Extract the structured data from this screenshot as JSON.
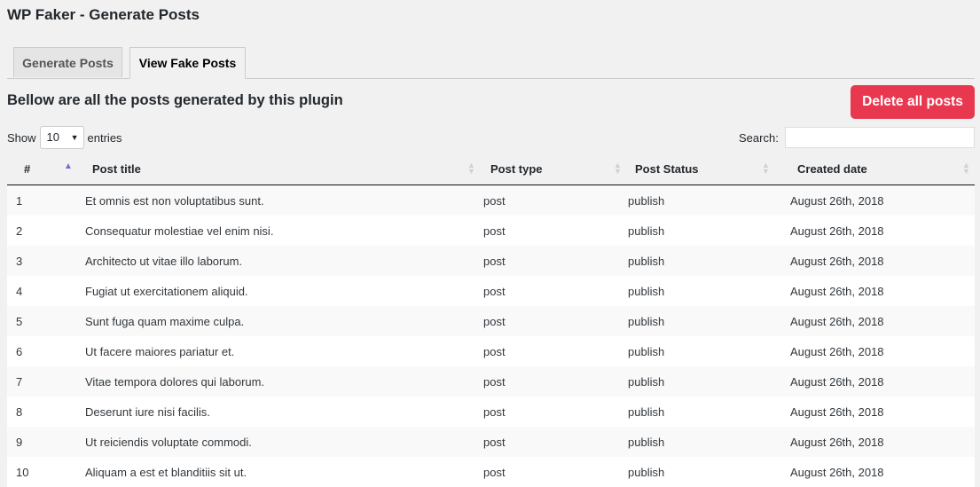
{
  "page": {
    "title": "WP Faker - Generate Posts"
  },
  "tabs": [
    {
      "label": "Generate Posts",
      "active": false
    },
    {
      "label": "View Fake Posts",
      "active": true
    }
  ],
  "section": {
    "heading": "Bellow are all the posts generated by this plugin",
    "delete_label": "Delete all posts",
    "delete_color": "#e8384f"
  },
  "controls": {
    "show_label": "Show",
    "page_length": "10",
    "entries_label": "entries",
    "search_label": "Search:",
    "search_value": ""
  },
  "table": {
    "columns": [
      "#",
      "Post title",
      "Post type",
      "Post Status",
      "Created date"
    ],
    "sorted_column": "#",
    "sort_direction": "asc",
    "rows": [
      {
        "num": "1",
        "title": "Et omnis est non voluptatibus sunt.",
        "type": "post",
        "status": "publish",
        "date": "August 26th, 2018"
      },
      {
        "num": "2",
        "title": "Consequatur molestiae vel enim nisi.",
        "type": "post",
        "status": "publish",
        "date": "August 26th, 2018"
      },
      {
        "num": "3",
        "title": "Architecto ut vitae illo laborum.",
        "type": "post",
        "status": "publish",
        "date": "August 26th, 2018"
      },
      {
        "num": "4",
        "title": "Fugiat ut exercitationem aliquid.",
        "type": "post",
        "status": "publish",
        "date": "August 26th, 2018"
      },
      {
        "num": "5",
        "title": "Sunt fuga quam maxime culpa.",
        "type": "post",
        "status": "publish",
        "date": "August 26th, 2018"
      },
      {
        "num": "6",
        "title": "Ut facere maiores pariatur et.",
        "type": "post",
        "status": "publish",
        "date": "August 26th, 2018"
      },
      {
        "num": "7",
        "title": "Vitae tempora dolores qui laborum.",
        "type": "post",
        "status": "publish",
        "date": "August 26th, 2018"
      },
      {
        "num": "8",
        "title": "Deserunt iure nisi facilis.",
        "type": "post",
        "status": "publish",
        "date": "August 26th, 2018"
      },
      {
        "num": "9",
        "title": "Ut reiciendis voluptate commodi.",
        "type": "post",
        "status": "publish",
        "date": "August 26th, 2018"
      },
      {
        "num": "10",
        "title": "Aliquam a est et blanditiis sit ut.",
        "type": "post",
        "status": "publish",
        "date": "August 26th, 2018"
      }
    ]
  },
  "icons": {
    "sort_asc": "sort-ascending-icon",
    "sort_both": "sort-both-icon",
    "select_arrow": "chevron-down-icon"
  }
}
